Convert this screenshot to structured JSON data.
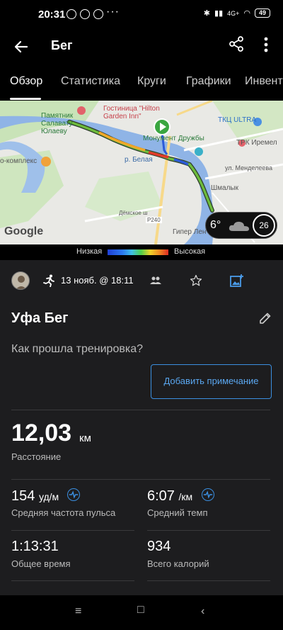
{
  "status": {
    "time": "20:31",
    "battery": "49",
    "network": "4G+"
  },
  "appbar": {
    "title": "Бег",
    "back_icon": "arrow-left-icon",
    "share_icon": "share-icon",
    "more_icon": "more-vert-icon"
  },
  "tabs": [
    {
      "label": "Обзор",
      "active": true
    },
    {
      "label": "Статистика",
      "active": false
    },
    {
      "label": "Круги",
      "active": false
    },
    {
      "label": "Графики",
      "active": false
    },
    {
      "label": "Инвента",
      "active": false
    }
  ],
  "map": {
    "labels": [
      "Памятник Салавату Юлаеву",
      "Гостиница \"Hilton Garden Inn\"",
      "ТКЦ ULTRA",
      "Монумент Дружбы",
      "ТРК Иремел",
      "р. Белая",
      "ул. Менделеева",
      "Шмалык",
      "Гипер Лен",
      "Р240",
      "Дёмское ш",
      "о-комплекс"
    ],
    "google": "Google",
    "weather": {
      "temp": "6°",
      "wind": "26"
    }
  },
  "legend": {
    "low": "Низкая",
    "high": "Высокая"
  },
  "activity": {
    "date": "13 нояб. @ 18:11",
    "title": "Уфа Бег",
    "question": "Как прошла тренировка?",
    "add_note": "Добавить примечание"
  },
  "stats": {
    "distance": {
      "value": "12,03",
      "unit": "км",
      "label": "Расстояние"
    },
    "hr": {
      "value": "154",
      "unit": "уд/м",
      "label": "Средняя частота пульса"
    },
    "pace": {
      "value": "6:07",
      "unit": "/км",
      "label": "Средний темп"
    },
    "time": {
      "value": "1:13:31",
      "label": "Общее время"
    },
    "calories": {
      "value": "934",
      "label": "Всего калорий"
    }
  }
}
